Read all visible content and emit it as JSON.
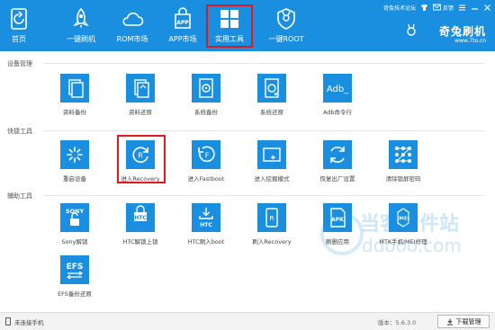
{
  "nav": {
    "items": [
      {
        "label": "首页",
        "icon": "refresh-icon"
      },
      {
        "label": "一键刷机",
        "icon": "rocket-icon"
      },
      {
        "label": "ROM市场",
        "icon": "cloud-icon"
      },
      {
        "label": "APP市场",
        "icon": "app-store-icon"
      },
      {
        "label": "实用工具",
        "icon": "windows-grid-icon",
        "active": true
      },
      {
        "label": "一键ROOT",
        "icon": "shield-icon"
      }
    ]
  },
  "topbar": {
    "forum": "奇兔技术论坛",
    "feedback": "反馈"
  },
  "brand": {
    "name": "奇兔刷机",
    "url": "www.7to.cn"
  },
  "sections": [
    {
      "title": "设备管理"
    },
    {
      "title": "快捷工具"
    },
    {
      "title": "辅助工具"
    }
  ],
  "tiles": {
    "device": [
      {
        "label": "资料备份",
        "icon": "doc-backup-icon"
      },
      {
        "label": "资料还原",
        "icon": "doc-restore-icon"
      },
      {
        "label": "系统备份",
        "icon": "system-backup-icon"
      },
      {
        "label": "系统还原",
        "icon": "system-restore-icon"
      },
      {
        "label": "Adb命令行",
        "icon": "adb-icon",
        "text": "Adb_"
      }
    ],
    "quick": [
      {
        "label": "重启设备",
        "icon": "restart-icon"
      },
      {
        "label": "进入Recovery",
        "icon": "recovery-icon",
        "letter": "R"
      },
      {
        "label": "进入Fastboot",
        "icon": "fastboot-icon",
        "letter": "F"
      },
      {
        "label": "进入挖掘模式",
        "icon": "download-mode-icon"
      },
      {
        "label": "恢复出厂设置",
        "icon": "factory-reset-icon"
      },
      {
        "label": "清除锁屏密码",
        "icon": "pattern-lock-icon"
      }
    ],
    "aux": [
      {
        "label": "Sony解锁",
        "icon": "sony-unlock-icon",
        "text": "SONY"
      },
      {
        "label": "HTC解锁上锁",
        "icon": "htc-lock-icon",
        "text": "HTC"
      },
      {
        "label": "HTC刷入boot",
        "icon": "htc-boot-icon",
        "text": "HTC"
      },
      {
        "label": "刷入Recovery",
        "icon": "flash-recovery-icon",
        "letter": "R"
      },
      {
        "label": "刷删应用",
        "icon": "apk-icon",
        "text": "APK"
      },
      {
        "label": "MTK手机IMEI修理",
        "icon": "imei-icon",
        "text": "IMEI"
      },
      {
        "label": "EFS备份还原",
        "icon": "efs-icon",
        "text": "EFS"
      }
    ]
  },
  "status": {
    "text": "未连接手机",
    "version": "版本：5.6.3.0",
    "download_label": "下载管理"
  },
  "watermark": {
    "text": "当客软件站",
    "url": "ddooo.com"
  },
  "colors": {
    "primary": "#1a8fe0",
    "highlight": "#e0181f"
  }
}
